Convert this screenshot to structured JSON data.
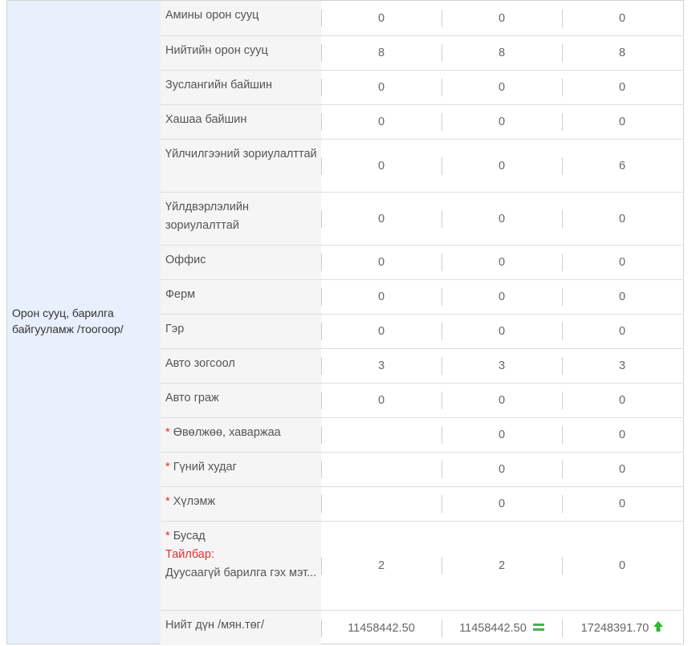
{
  "category": {
    "label": "Орон сууц, барилга байгууламж /тоогоор/"
  },
  "rows": [
    {
      "label": "Амины орон сууц",
      "v1": "0",
      "v2": "0",
      "v3": "0"
    },
    {
      "label": "Нийтийн орон сууц",
      "v1": "8",
      "v2": "8",
      "v3": "8"
    },
    {
      "label": "Зуслангийн байшин",
      "v1": "0",
      "v2": "0",
      "v3": "0"
    },
    {
      "label": "Хашаа байшин",
      "v1": "0",
      "v2": "0",
      "v3": "0"
    },
    {
      "label": "Үйлчилгээний зориулалттай",
      "v1": "0",
      "v2": "0",
      "v3": "6"
    },
    {
      "label": "Үйлдвэрлэлийн зориулалттай",
      "v1": "0",
      "v2": "0",
      "v3": "0"
    },
    {
      "label": "Оффис",
      "v1": "0",
      "v2": "0",
      "v3": "0"
    },
    {
      "label": "Ферм",
      "v1": "0",
      "v2": "0",
      "v3": "0"
    },
    {
      "label": "Гэр",
      "v1": "0",
      "v2": "0",
      "v3": "0"
    },
    {
      "label": "Авто зогсоол",
      "v1": "3",
      "v2": "3",
      "v3": "3"
    },
    {
      "label": "Авто граж",
      "v1": "0",
      "v2": "0",
      "v3": "0"
    },
    {
      "star": "*",
      "label": "Өвөлжөө, хаваржаа",
      "v1": "",
      "v2": "0",
      "v3": "0"
    },
    {
      "star": "*",
      "label": "Гүний худаг",
      "v1": "",
      "v2": "0",
      "v3": "0"
    },
    {
      "star": "*",
      "label": "Хүлэмж",
      "v1": "",
      "v2": "0",
      "v3": "0"
    },
    {
      "star": "*",
      "label": "Бусад",
      "note_label": "Тайлбар:",
      "note_text": "Дуусаагүй барилга гэх мэт...",
      "v1": "2",
      "v2": "2",
      "v3": "0"
    }
  ],
  "total": {
    "label": "Нийт дүн /мян.төг/",
    "v1": "11458442.50",
    "v2": "11458442.50",
    "v3": "17248391.70",
    "v2_icon": "equal-icon",
    "v3_icon": "arrow-up-icon",
    "icon_color": "#4caf50"
  },
  "colors": {
    "category_bg": "#e7f0fc",
    "label_bg": "#f5f5f5",
    "required_star": "#e03030"
  }
}
